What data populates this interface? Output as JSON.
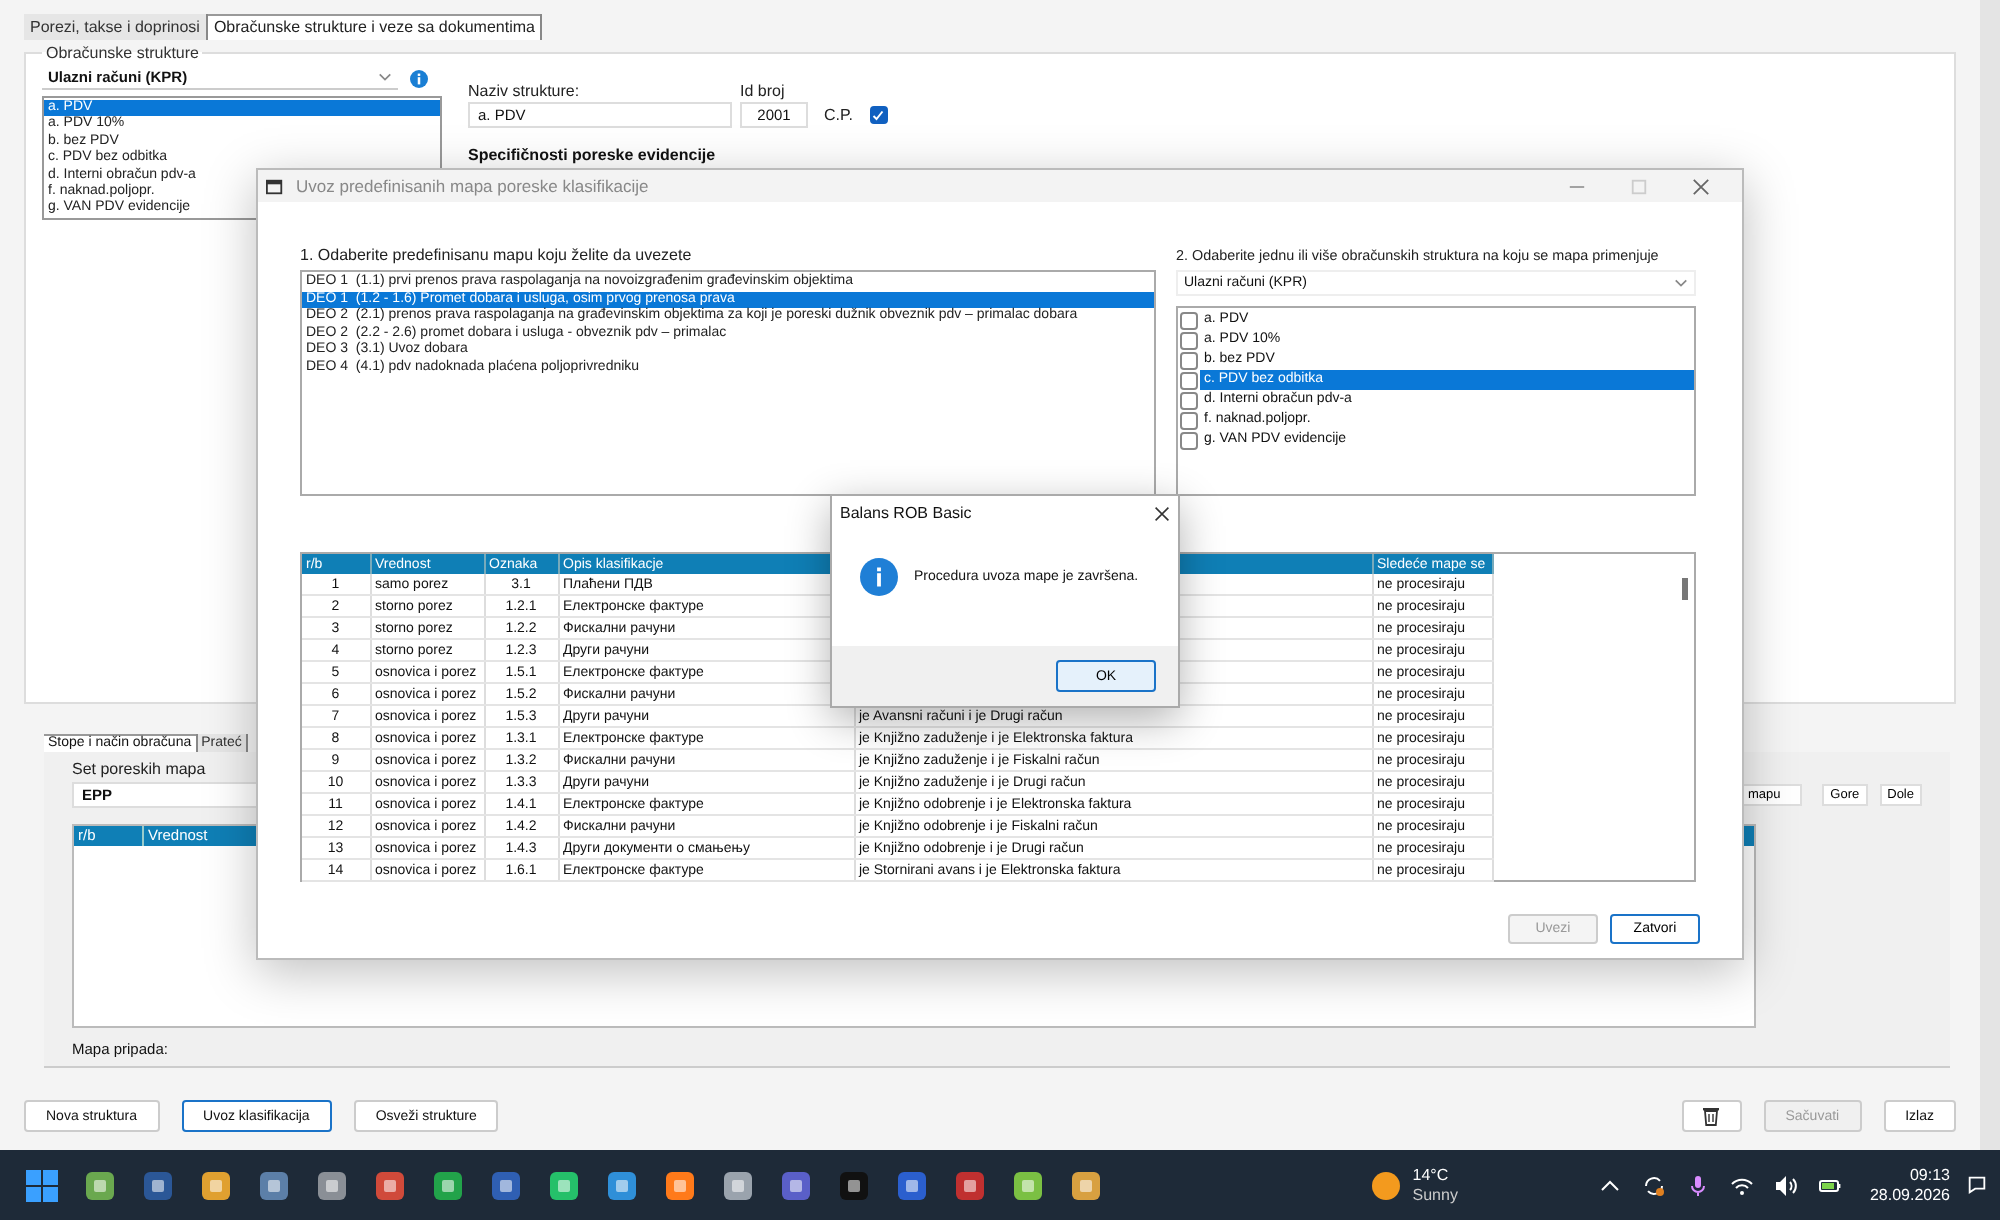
{
  "app_tabs": [
    {
      "label": "Porezi, takse i doprinosi",
      "selected": false
    },
    {
      "label": "Obračunske strukture i veze sa dokumentima",
      "selected": true
    }
  ],
  "structures": {
    "title": "Obračunske strukture",
    "combo": "Ulazni računi (KPR)",
    "items": [
      {
        "label": "a. PDV",
        "selected": true
      },
      {
        "label": "a. PDV 10%",
        "selected": false
      },
      {
        "label": "b. bez PDV",
        "selected": false
      },
      {
        "label": "c. PDV bez odbitka",
        "selected": false
      },
      {
        "label": "d. Interni obračun pdv-a",
        "selected": false
      },
      {
        "label": "f. naknad.poljopr.",
        "selected": false
      },
      {
        "label": "g. VAN PDV evidencije",
        "selected": false
      }
    ]
  },
  "details": {
    "name_label": "Naziv strukture:",
    "name_value": "a. PDV",
    "id_label": "Id broj",
    "id_value": "2001",
    "cp_label": "C.P.",
    "cp_checked": true,
    "section_title": "Specifičnosti poreske evidencije"
  },
  "lower_tabs": [
    {
      "label": "Stope i način obračuna",
      "selected": true
    },
    {
      "label": "Prateć",
      "selected": false
    }
  ],
  "tax_map_set": {
    "label": "Set poreskih mapa",
    "value": "EPP",
    "columns": [
      "r/b",
      "Vrednost"
    ],
    "belongs_label": "Mapa pripada:",
    "side_buttons": [
      "mapu",
      "Gore",
      "Dole"
    ]
  },
  "bottom_left_buttons": [
    {
      "label": "Nova struktura",
      "focused": false
    },
    {
      "label": "Uvoz klasifikacija",
      "focused": true
    },
    {
      "label": "Osveži strukture",
      "focused": false
    }
  ],
  "bottom_right_buttons": [
    {
      "kind": "icon",
      "disabled": false
    },
    {
      "kind": "text",
      "label": "Sačuvati",
      "disabled": true
    },
    {
      "kind": "text",
      "label": "Izlaz",
      "disabled": false
    }
  ],
  "dialog": {
    "title": "Uvoz predefinisanih mapa poreske klasifikacije",
    "step1_label": "1. Odaberite predefinisanu mapu koju želite da uvezete",
    "maps": [
      {
        "label": "DEO 1  (1.1) prvi prenos prava raspolaganja na novoizgrađenim građevinskim objektima",
        "selected": false
      },
      {
        "label": "DEO 1  (1.2 - 1.6) Promet dobara i usluga, osim prvog prenosa prava",
        "selected": true
      },
      {
        "label": "DEO 2  (2.1) prenos prava raspolaganja na građevinskim objektima za koji je poreski dužnik obveznik pdv – primalac dobara",
        "selected": false
      },
      {
        "label": "DEO 2  (2.2 - 2.6) promet dobara i usluga - obveznik pdv – primalac",
        "selected": false
      },
      {
        "label": "DEO 3  (3.1) Uvoz dobara",
        "selected": false
      },
      {
        "label": "DEO 4  (4.1) pdv nadoknada plaćena poljoprivredniku",
        "selected": false
      }
    ],
    "step2_label": "2. Odaberite jednu ili više obračunskih struktura na koju se mapa primenjuje",
    "combo": "Ulazni računi (KPR)",
    "structures": [
      {
        "label": "a. PDV",
        "checked": false,
        "selected": false
      },
      {
        "label": "a. PDV 10%",
        "checked": false,
        "selected": false
      },
      {
        "label": "b. bez PDV",
        "checked": false,
        "selected": false
      },
      {
        "label": "c. PDV bez odbitka",
        "checked": false,
        "selected": true
      },
      {
        "label": "d. Interni obračun pdv-a",
        "checked": false,
        "selected": false
      },
      {
        "label": "f. naknad.poljopr.",
        "checked": false,
        "selected": false
      },
      {
        "label": "g. VAN PDV evidencije",
        "checked": false,
        "selected": false
      }
    ],
    "table": {
      "columns": [
        "r/b",
        "Vrednost",
        "Oznaka",
        "Opis klasifikacje",
        "",
        "Sledeće mape se"
      ],
      "rows": [
        {
          "rb": "1",
          "value": "samo porez",
          "code": "3.1",
          "description": "Плаћени ПДВ",
          "next": "ne procesiraju"
        },
        {
          "rb": "2",
          "value": "storno porez",
          "code": "1.2.1",
          "description": "Електронске фактуре",
          "next": "ne procesiraju"
        },
        {
          "rb": "3",
          "value": "storno porez",
          "code": "1.2.2",
          "description": "Фискални рачуни",
          "next": "ne procesiraju"
        },
        {
          "rb": "4",
          "value": "storno porez",
          "code": "1.2.3",
          "description": "Други рачуни",
          "next": "ne procesiraju"
        },
        {
          "rb": "5",
          "value": "osnovica i porez",
          "code": "1.5.1",
          "description": "Електронске фактуре",
          "next": "ne procesiraju"
        },
        {
          "rb": "6",
          "value": "osnovica i porez",
          "code": "1.5.2",
          "description": "Фискални рачуни",
          "next": "ne procesiraju"
        },
        {
          "rb": "7",
          "value": "osnovica i porez",
          "code": "1.5.3",
          "description": "Други рачуни",
          "column_5": "je Avansni računi i  je Drugi račun",
          "next": "ne procesiraju"
        },
        {
          "rb": "8",
          "value": "osnovica i porez",
          "code": "1.3.1",
          "description": "Електронске фактуре",
          "column_5": "je Knjižno zaduženje i  je Elektronska faktura",
          "next": "ne procesiraju"
        },
        {
          "rb": "9",
          "value": "osnovica i porez",
          "code": "1.3.2",
          "description": "Фискални рачуни",
          "column_5": "je Knjižno zaduženje i  je Fiskalni račun",
          "next": "ne procesiraju"
        },
        {
          "rb": "10",
          "value": "osnovica i porez",
          "code": "1.3.3",
          "description": "Други рачуни",
          "column_5": "je Knjižno zaduženje i  je Drugi račun",
          "next": "ne procesiraju"
        },
        {
          "rb": "11",
          "value": "osnovica i porez",
          "code": "1.4.1",
          "description": "Електронске фактуре",
          "column_5": "je Knjižno odobrenje i  je Elektronska faktura",
          "next": "ne procesiraju"
        },
        {
          "rb": "12",
          "value": "osnovica i porez",
          "code": "1.4.2",
          "description": "Фискални рачуни",
          "column_5": "je Knjižno odobrenje i  je Fiskalni račun",
          "next": "ne procesiraju"
        },
        {
          "rb": "13",
          "value": "osnovica i porez",
          "code": "1.4.3",
          "description": "Други документи о смањењу",
          "column_5": "je Knjižno odobrenje i  je Drugi račun",
          "next": "ne procesiraju"
        },
        {
          "rb": "14",
          "value": "osnovica i porez",
          "code": "1.6.1",
          "description": "Електронске фактуре",
          "column_5": "je Stornirani avans i  je Elektronska faktura",
          "next": "ne procesiraju"
        }
      ]
    },
    "buttons": [
      {
        "label": "Uvezi",
        "disabled": true
      },
      {
        "label": "Zatvori",
        "disabled": false
      }
    ]
  },
  "message_box": {
    "title": "Balans ROB Basic",
    "message": "Procedura uvoza mape je završena.",
    "button": "OK"
  },
  "taskbar": {
    "weather": {
      "temperature": "14°C",
      "condition": "Sunny"
    },
    "time": "09:13",
    "date": "28.09.2026"
  }
}
